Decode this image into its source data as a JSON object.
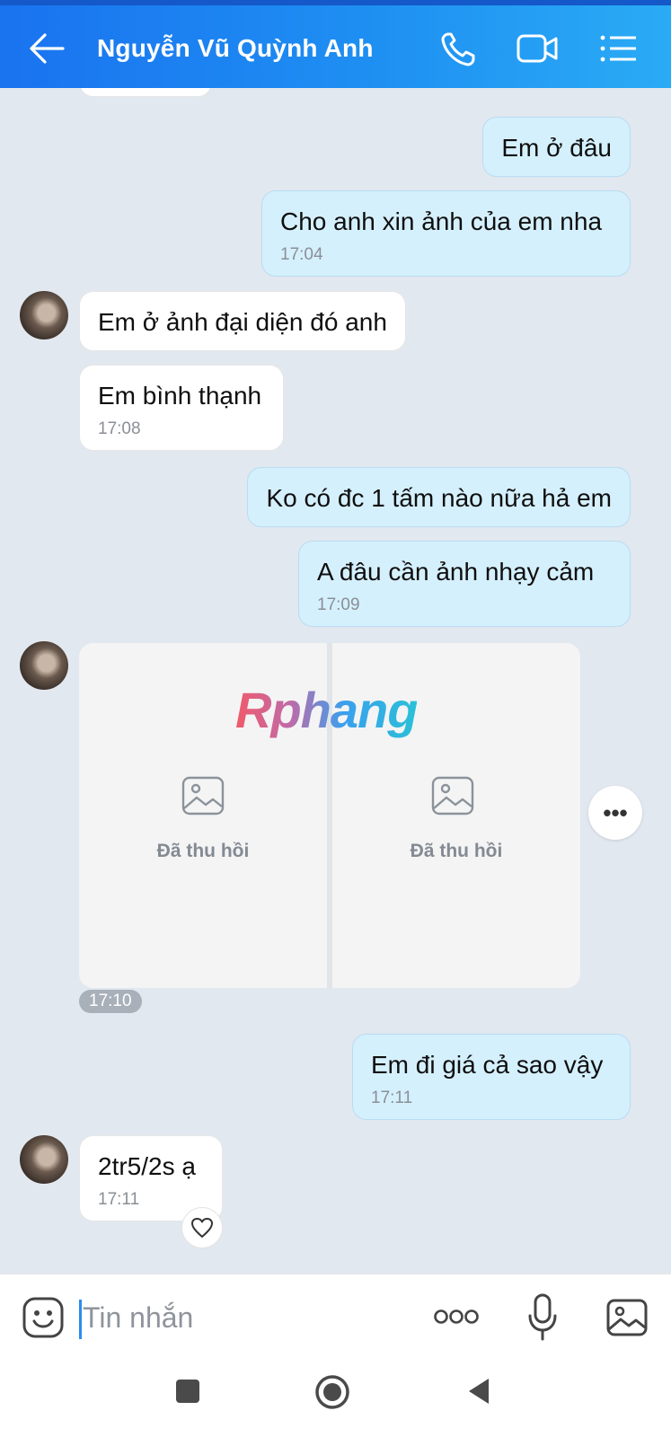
{
  "header": {
    "title": "Nguyễn Vũ Quỳnh Anh",
    "icons": [
      "back-arrow-icon",
      "phone-icon",
      "video-call-icon",
      "menu-list-icon"
    ]
  },
  "messages": [
    {
      "side": "out",
      "text": "Em ở đâu"
    },
    {
      "side": "out",
      "text": "Cho anh xin ảnh của em nha",
      "time": "17:04"
    },
    {
      "side": "in",
      "text": "Em ở ảnh đại diện đó anh"
    },
    {
      "side": "in",
      "text": "Em bình thạnh",
      "time": "17:08"
    },
    {
      "side": "out",
      "text": "Ko có đc 1 tấm nào nữa hả em"
    },
    {
      "side": "out",
      "text": "A đâu cần ảnh nhạy cảm",
      "time": "17:09"
    },
    {
      "side": "out",
      "text": "Em đi giá cả sao vậy",
      "time": "17:11"
    },
    {
      "side": "in",
      "text": "2tr5/2s ạ",
      "time": "17:11"
    }
  ],
  "media": {
    "recalled_label_left": "Đã thu hồi",
    "recalled_label_right": "Đã thu hồi",
    "time": "17:10",
    "more_label": "•••"
  },
  "watermark": "Rphang",
  "composer": {
    "placeholder": "Tin nhắn",
    "more_dots": "ooo"
  },
  "colors": {
    "header_start": "#1a73f0",
    "header_end": "#2aabf5",
    "out_bubble": "#d5f0fd",
    "in_bubble": "#ffffff",
    "chat_bg": "#e2e8ef"
  }
}
